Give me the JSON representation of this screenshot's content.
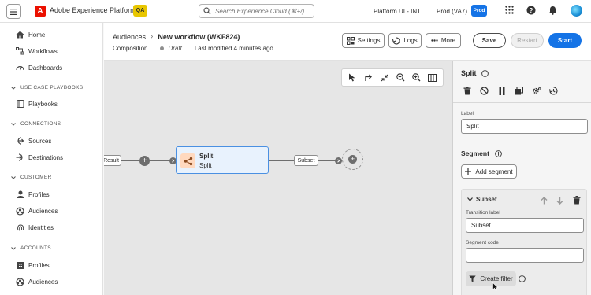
{
  "topbar": {
    "app_name": "Adobe Experience Platform",
    "logo_letter": "A",
    "env_badge": "QA",
    "search_placeholder": "Search Experience Cloud (⌘+/)",
    "org": "Platform UI - INT",
    "sandbox": "Prod (VA7)",
    "sandbox_badge": "Prod",
    "icons": [
      "grid-icon",
      "help-icon",
      "bell-icon",
      "avatar"
    ]
  },
  "sidebar": {
    "items_top": [
      {
        "label": "Home",
        "icon": "home-icon"
      },
      {
        "label": "Workflows",
        "icon": "workflow-icon"
      },
      {
        "label": "Dashboards",
        "icon": "dashboard-icon"
      }
    ],
    "sections": [
      {
        "title": "USE CASE PLAYBOOKS",
        "items": [
          {
            "label": "Playbooks",
            "icon": "book-icon"
          }
        ]
      },
      {
        "title": "CONNECTIONS",
        "items": [
          {
            "label": "Sources",
            "icon": "sources-icon"
          },
          {
            "label": "Destinations",
            "icon": "destinations-icon"
          }
        ]
      },
      {
        "title": "CUSTOMER",
        "items": [
          {
            "label": "Profiles",
            "icon": "person-icon"
          },
          {
            "label": "Audiences",
            "icon": "audiences-icon"
          },
          {
            "label": "Identities",
            "icon": "fingerprint-icon"
          }
        ]
      },
      {
        "title": "ACCOUNTS",
        "items": [
          {
            "label": "Profiles",
            "icon": "building-icon"
          },
          {
            "label": "Audiences",
            "icon": "audiences-icon"
          }
        ]
      }
    ]
  },
  "header": {
    "breadcrumb_parent": "Audiences",
    "breadcrumb_sep": "›",
    "title": "New workflow (WKF824)",
    "subtitle": "Composition",
    "status": "Draft",
    "modified": "Last modified 4 minutes ago",
    "buttons": {
      "settings": "Settings",
      "logs": "Logs",
      "more": "More",
      "save": "Save",
      "restart": "Restart",
      "start": "Start"
    }
  },
  "canvas": {
    "prev_node_label": "Result",
    "node_title": "Split",
    "node_subtitle": "Split",
    "out_transition": "Subset",
    "plus": "+"
  },
  "panel": {
    "title": "Split",
    "label_caption": "Label",
    "label_value": "Split",
    "segment_title": "Segment",
    "add_segment": "Add segment",
    "segment_name": "Subset",
    "transition_label_caption": "Transition label",
    "transition_label_value": "Subset",
    "segment_code_caption": "Segment code",
    "segment_code_value": "",
    "create_filter": "Create filter"
  },
  "colors": {
    "accent": "#1473e6",
    "adobe_red": "#eb1000",
    "qa_yellow": "#e8c600",
    "node_border": "#4a90e2"
  }
}
